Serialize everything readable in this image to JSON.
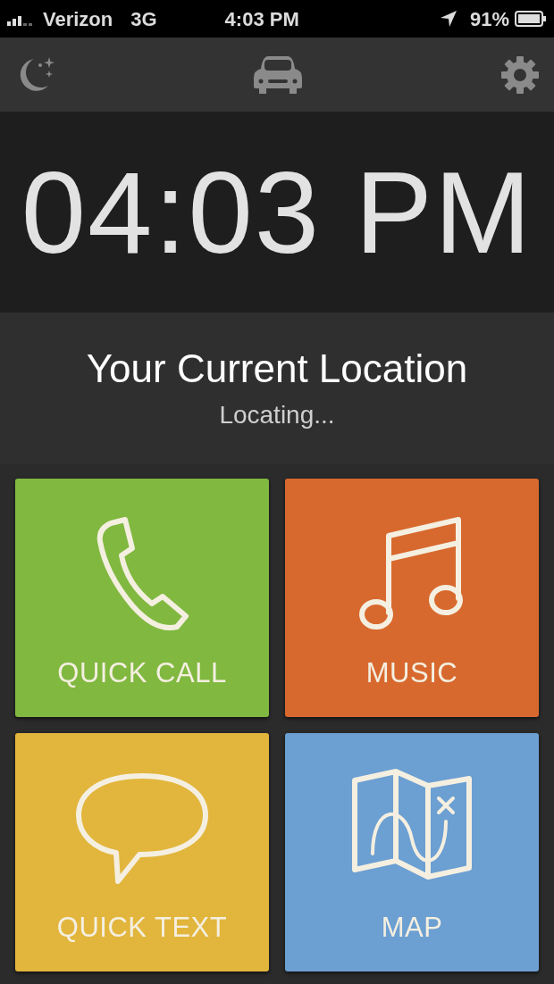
{
  "status_bar": {
    "carrier": "Verizon",
    "network": "3G",
    "time": "4:03 PM",
    "battery": "91%"
  },
  "clock": {
    "time": "04:03 PM"
  },
  "location": {
    "title": "Your Current Location",
    "status": "Locating..."
  },
  "tiles": [
    {
      "kind": "call",
      "label": "QUICK CALL",
      "color": "#80b840"
    },
    {
      "kind": "music",
      "label": "MUSIC",
      "color": "#d8692e"
    },
    {
      "kind": "text",
      "label": "QUICK TEXT",
      "color": "#e2b53c"
    },
    {
      "kind": "map",
      "label": "MAP",
      "color": "#6c9fd2"
    }
  ]
}
